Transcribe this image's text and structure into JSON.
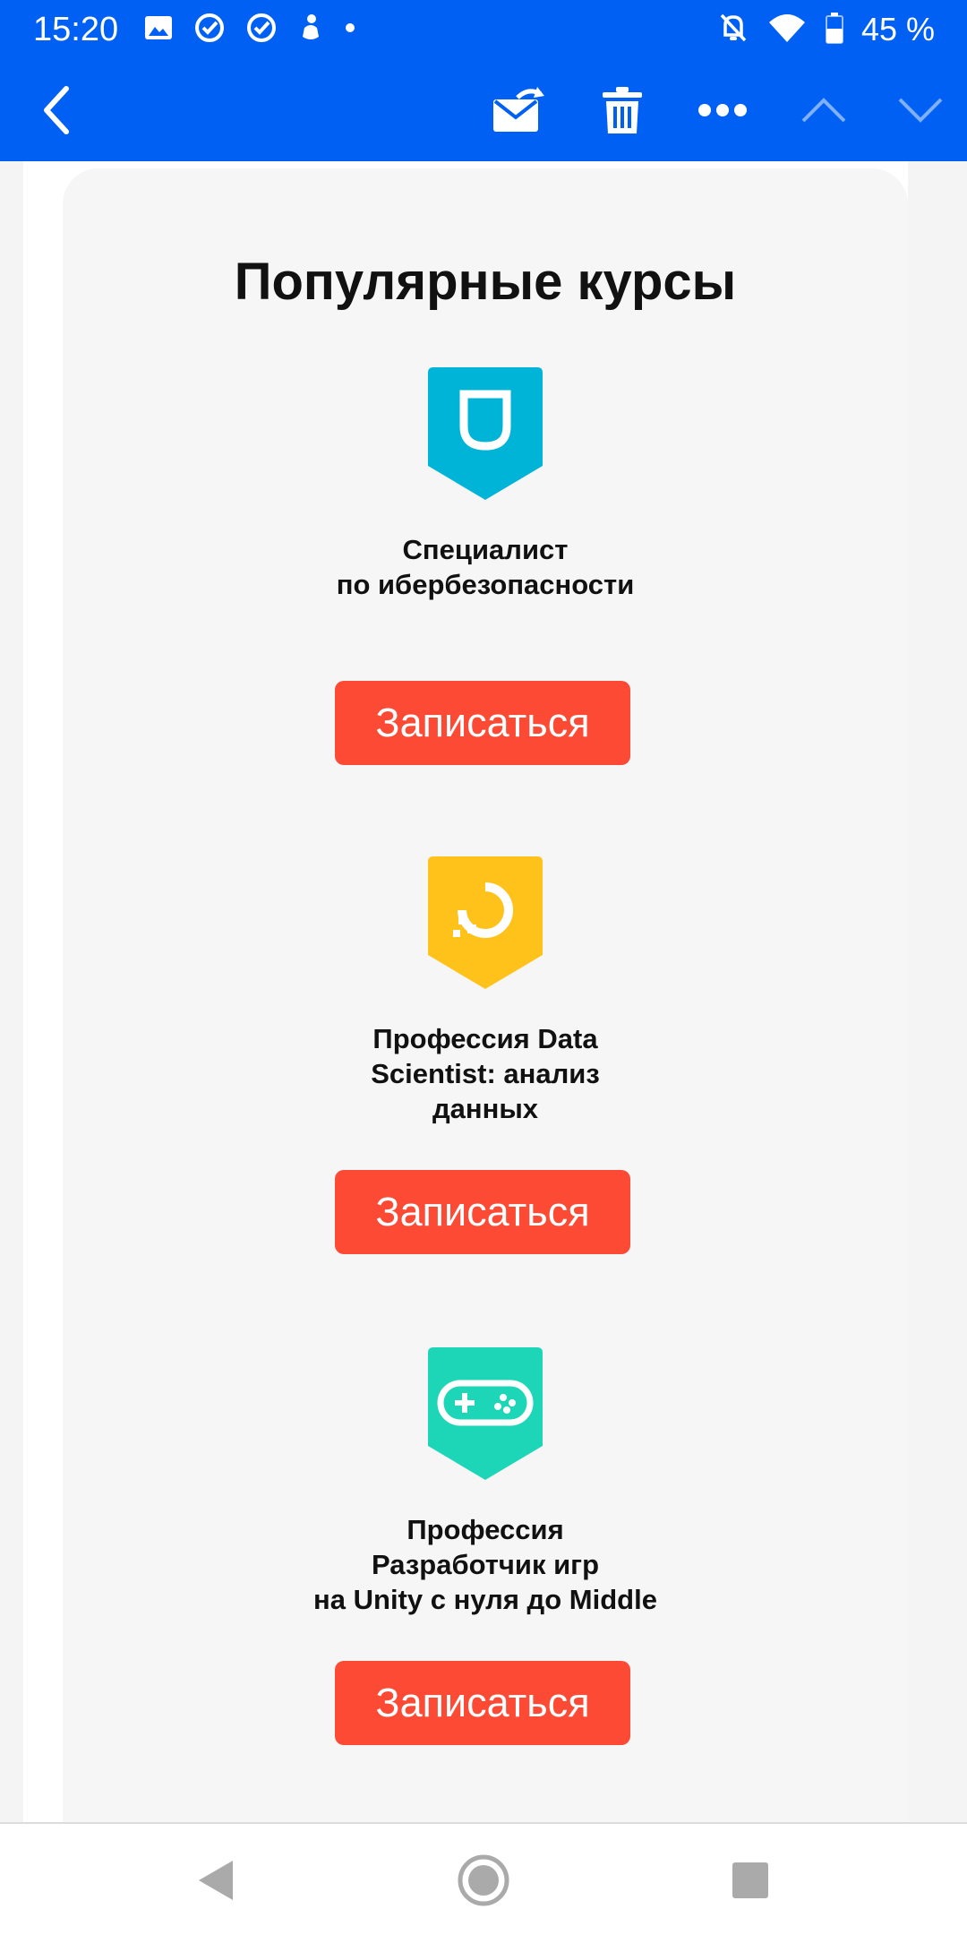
{
  "status_bar": {
    "time": "15:20",
    "battery_percent": "45 %",
    "left_icons": [
      "image-icon",
      "check-circle-icon",
      "check-circle-icon",
      "app-notification-icon",
      "dot-icon"
    ],
    "right_icons": [
      "bell-off-icon",
      "wifi-icon",
      "battery-icon"
    ]
  },
  "toolbar": {
    "buttons": [
      "back-icon",
      "mark-unread-icon",
      "trash-icon",
      "more-icon",
      "previous-icon",
      "next-icon"
    ]
  },
  "section": {
    "title": "Популярные курсы"
  },
  "courses": [
    {
      "name_lines": [
        "Специалист",
        "по ибербезопасности"
      ],
      "button_label": "Записаться",
      "icon": "shield-badge-icon",
      "icon_color": "#00b4d8"
    },
    {
      "name_lines": [
        "Профессия Data",
        "Scientist: анализ",
        "данных"
      ],
      "button_label": "Записаться",
      "icon": "data-badge-icon",
      "icon_color": "#ffc21a"
    },
    {
      "name_lines": [
        "Профессия",
        "Разработчик игр",
        "на Unity с нуля до Middle"
      ],
      "button_label": "Записаться",
      "icon": "gamepad-badge-icon",
      "icon_color": "#1dd6b8"
    }
  ],
  "colors": {
    "toolbar": "#0060f3",
    "button": "#fc4a35",
    "card": "#f6f6f6"
  },
  "nav": {
    "buttons": [
      "nav-back-icon",
      "nav-home-icon",
      "nav-recents-icon"
    ]
  }
}
